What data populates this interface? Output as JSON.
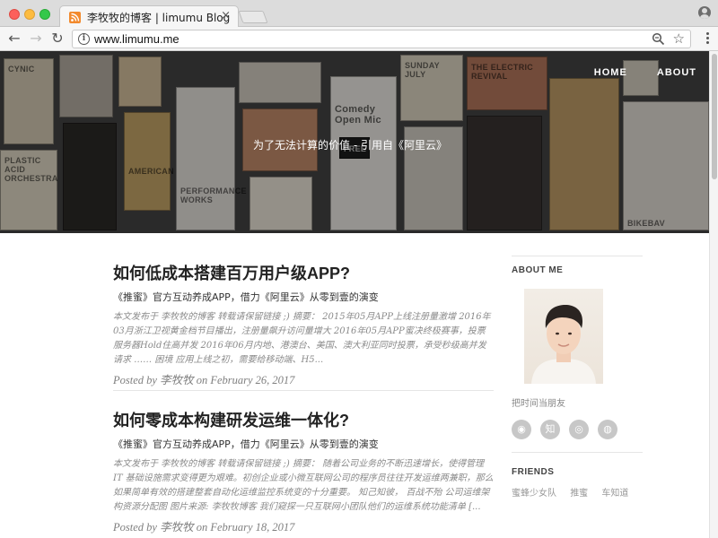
{
  "browser": {
    "tab_title": "李牧牧的博客 | limumu Blog",
    "tab_close": "×",
    "url": "www.limumu.me",
    "back_glyph": "←",
    "forward_glyph": "→",
    "reload_glyph": "↻",
    "info_glyph": "i",
    "star_glyph": "☆"
  },
  "hero": {
    "nav": [
      {
        "label": "HOME"
      },
      {
        "label": "ABOUT"
      }
    ],
    "subtitle": "为了无法计算的价值 - 引用自《阿里云》",
    "posters": [
      {
        "text": "Comedy Open Mic"
      },
      {
        "text": "PLASTIC ACID ORCHESTRA"
      },
      {
        "text": "AMERICAN"
      },
      {
        "text": "SUNDAY JULY"
      },
      {
        "text": "THE ELECTRIC REVIVAL"
      },
      {
        "text": "FREE"
      },
      {
        "text": "PERFORMANCE WORKS"
      },
      {
        "text": "CYNIC"
      },
      {
        "text": "BIKEBAV"
      }
    ]
  },
  "posts": [
    {
      "title": "如何低成本搭建百万用户级APP?",
      "subtitle": "《推蜜》官方互动养成APP，借力《阿里云》从零到壹的演变",
      "excerpt": "本文发布于 李牧牧的博客 转载请保留链接 ;) 摘要： 2015年05月APP上线注册量激增 2016年03月浙江卫视黄金档节目播出，注册量飙升访问量增大 2016年05月APP蜜决终极赛事，投票服务器Hold住高并发 2016年06月内地、港澳台、美国、澳大利亚同时投票，承受秒级高并发请求 …… 困境 应用上线之初，需要给移动端、H5...",
      "meta": "Posted by 李牧牧 on February 26, 2017"
    },
    {
      "title": "如何零成本构建研发运维一体化?",
      "subtitle": "《推蜜》官方互动养成APP，借力《阿里云》从零到壹的演变",
      "excerpt": "本文发布于 李牧牧的博客 转载请保留链接 ;) 摘要： 随着公司业务的不断迅速增长，使得管理 IT 基础设施需求变得更为艰难。初创企业或小微互联网公司的程序员往往开发运维两兼职，那么如果简单有效的搭建整套自动化运维监控系统变的十分重要。 知己知彼， 百战不殆 公司运维架构资源分配图 图片来源: 李牧牧博客 我们窥探一只互联网小团队他们的运维系统功能清单 [...",
      "meta": "Posted by 李牧牧 on February 18, 2017"
    }
  ],
  "sidebar": {
    "about_heading": "ABOUT ME",
    "bio": "把时间当朋友",
    "social": [
      {
        "icon": "rss-icon",
        "glyph": "◉"
      },
      {
        "icon": "zhihu-icon",
        "glyph": "知"
      },
      {
        "icon": "weibo-icon",
        "glyph": "◎"
      },
      {
        "icon": "github-icon",
        "glyph": "◍"
      }
    ],
    "friends_heading": "FRIENDS",
    "friends": [
      "蜜蜂少女队",
      "推蜜",
      "车知道"
    ]
  },
  "colors": {
    "accent_text": "#222222",
    "muted_text": "#8a8a8a",
    "social_bg": "#c7c7c7",
    "feed_favicon": "#f28a2e"
  }
}
